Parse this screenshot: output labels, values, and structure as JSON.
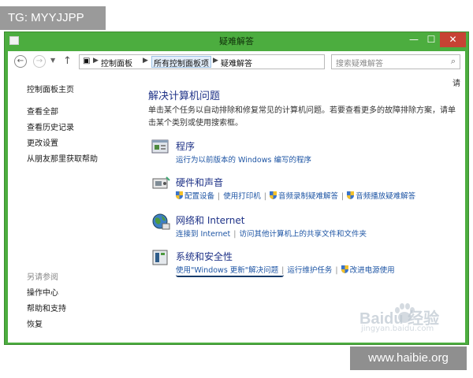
{
  "watermark": {
    "tag": "TG: MYYJJPP",
    "site": "www.haibie.org",
    "baidu": "Baidu 经验",
    "baidu_url": "jingyan.baidu.com"
  },
  "window": {
    "title": "疑难解答",
    "min": "—",
    "max": "☐",
    "close": "✕"
  },
  "address": {
    "crumbs": [
      "控制面板",
      "所有控制面板项",
      "疑难解答"
    ],
    "search_placeholder": "搜索疑难解答"
  },
  "help": "请",
  "sidebar": {
    "home": "控制面板主页",
    "links": [
      "查看全部",
      "查看历史记录",
      "更改设置",
      "从朋友那里获取帮助"
    ],
    "see_also": "另请参阅",
    "see_also_links": [
      "操作中心",
      "帮助和支持",
      "恢复"
    ]
  },
  "main": {
    "title": "解决计算机问题",
    "description": "单击某个任务以自动排除和修复常见的计算机问题。若要查看更多的故障排除方案，请单击某个类别或使用搜索框。"
  },
  "categories": [
    {
      "title": "程序",
      "links": [
        "运行为以前版本的 Windows 编写的程序"
      ]
    },
    {
      "title": "硬件和声音",
      "links": [
        "配置设备",
        "使用打印机",
        "音频录制疑难解答",
        "音频播放疑难解答"
      ]
    },
    {
      "title": "网络和 Internet",
      "links": [
        "连接到 Internet",
        "访问其他计算机上的共享文件和文件夹"
      ]
    },
    {
      "title": "系统和安全性",
      "links": [
        "使用\"Windows 更新\"解决问题",
        "运行维护任务",
        "改进电源使用"
      ]
    }
  ]
}
